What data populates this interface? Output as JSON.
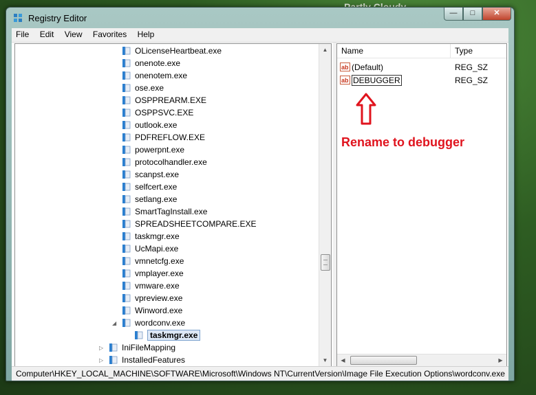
{
  "desktop": {
    "gadget_text": "Partly Cloudy"
  },
  "window": {
    "title": "Registry Editor",
    "buttons": {
      "minimize": "—",
      "maximize": "□",
      "close": "✕"
    }
  },
  "menu": [
    "File",
    "Edit",
    "View",
    "Favorites",
    "Help"
  ],
  "tree": {
    "items": [
      "OLicenseHeartbeat.exe",
      "onenote.exe",
      "onenotem.exe",
      "ose.exe",
      "OSPPREARM.EXE",
      "OSPPSVC.EXE",
      "outlook.exe",
      "PDFREFLOW.EXE",
      "powerpnt.exe",
      "protocolhandler.exe",
      "scanpst.exe",
      "selfcert.exe",
      "setlang.exe",
      "SmartTagInstall.exe",
      "SPREADSHEETCOMPARE.EXE",
      "taskmgr.exe",
      "UcMapi.exe",
      "vmnetcfg.exe",
      "vmplayer.exe",
      "vmware.exe",
      "vpreview.exe",
      "Winword.exe"
    ],
    "expanded_item": "wordconv.exe",
    "selected_child": "taskmgr.exe",
    "siblings": [
      "IniFileMapping",
      "InstalledFeatures"
    ]
  },
  "list": {
    "columns": [
      "Name",
      "Type"
    ],
    "rows": [
      {
        "name": "(Default)",
        "type": "REG_SZ"
      },
      {
        "name": "DEBUGGER",
        "type": "REG_SZ"
      }
    ]
  },
  "annotation": {
    "text": "Rename to debugger",
    "color": "#e0141e"
  },
  "statusbar": {
    "path": "Computer\\HKEY_LOCAL_MACHINE\\SOFTWARE\\Microsoft\\Windows NT\\CurrentVersion\\Image File Execution Options\\wordconv.exe"
  }
}
